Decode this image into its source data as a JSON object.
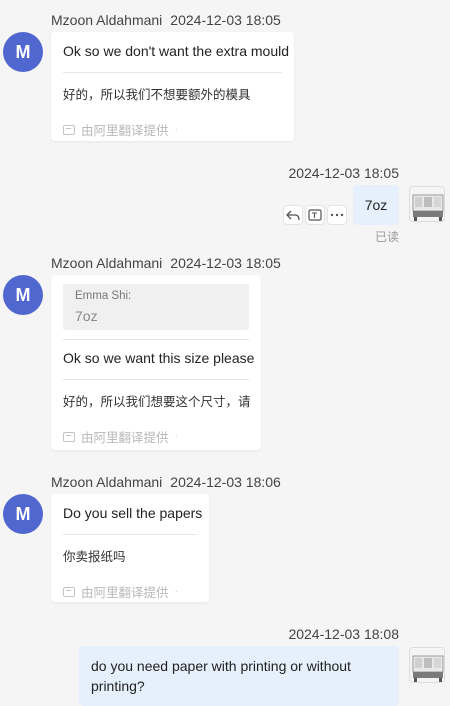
{
  "messages": [
    {
      "sender": "Mzoon Aldahmani",
      "timestamp": "2024-12-03 18:05",
      "avatar_letter": "M",
      "text": "Ok so we don't want the extra mould",
      "translation": "好的，所以我们不想要额外的模具",
      "credit": "由阿里翻译提供"
    },
    {
      "timestamp": "2024-12-03 18:05",
      "text": "7oz",
      "read_status": "已读"
    },
    {
      "sender": "Mzoon Aldahmani",
      "timestamp": "2024-12-03 18:05",
      "avatar_letter": "M",
      "quote_name": "Emma Shi:",
      "quote_text": "7oz",
      "text": "Ok so we want this size please",
      "translation": "好的，所以我们想要这个尺寸，请",
      "credit": "由阿里翻译提供"
    },
    {
      "sender": "Mzoon Aldahmani",
      "timestamp": "2024-12-03 18:06",
      "avatar_letter": "M",
      "text": "Do you sell the papers",
      "translation": "你卖报纸吗",
      "credit": "由阿里翻译提供"
    },
    {
      "timestamp": "2024-12-03 18:08",
      "text": "do you need paper with printing or without printing?"
    }
  ],
  "icons": {
    "reply": "reply-icon",
    "translate": "translate-icon",
    "more": "more-icon",
    "credit": "translate-credit-icon"
  },
  "colors": {
    "avatar": "#5067d0",
    "outgoing_bubble": "#e6f0fc",
    "background": "#f5f5f5"
  }
}
